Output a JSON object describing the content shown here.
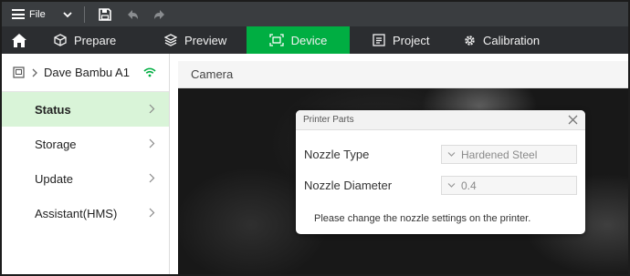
{
  "titlebar": {
    "file_label": "File",
    "icons": [
      "menu-icon",
      "chevron-down-icon",
      "save-icon",
      "undo-icon",
      "redo-icon"
    ]
  },
  "nav": {
    "tabs": [
      {
        "label": "Prepare",
        "icon": "cube-icon"
      },
      {
        "label": "Preview",
        "icon": "layers-icon"
      },
      {
        "label": "Device",
        "icon": "device-icon",
        "active": true
      },
      {
        "label": "Project",
        "icon": "project-icon"
      },
      {
        "label": "Calibration",
        "icon": "gear-icon"
      }
    ],
    "active_color": "#00ae42"
  },
  "sidebar": {
    "device_name": "Dave Bambu A1",
    "wifi_color": "#00ae42",
    "items": [
      {
        "label": "Status",
        "active": true
      },
      {
        "label": "Storage"
      },
      {
        "label": "Update"
      },
      {
        "label": "Assistant(HMS)"
      }
    ]
  },
  "main": {
    "header": "Camera"
  },
  "dialog": {
    "title": "Printer Parts",
    "rows": [
      {
        "label": "Nozzle Type",
        "value": "Hardened Steel"
      },
      {
        "label": "Nozzle Diameter",
        "value": "0.4"
      }
    ],
    "note": "Please change the nozzle settings on the printer."
  }
}
